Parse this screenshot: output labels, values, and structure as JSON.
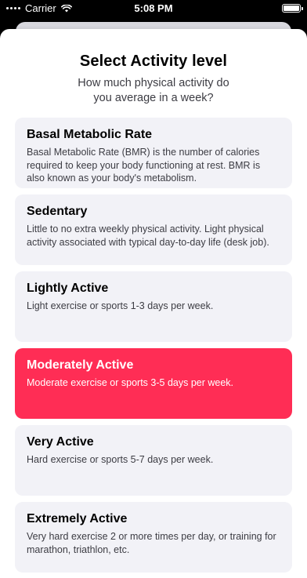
{
  "status_bar": {
    "carrier": "Carrier",
    "time": "5:08 PM"
  },
  "sheet": {
    "title": "Select Activity level",
    "subtitle": "How much physical activity do you average in a week?"
  },
  "activity_levels": [
    {
      "title": "Basal Metabolic Rate",
      "description": "Basal Metabolic Rate (BMR) is the number of calories required to keep your body functioning at rest. BMR is also known as your body's metabolism.",
      "selected": false
    },
    {
      "title": "Sedentary",
      "description": "Little to no extra weekly physical activity. Light physical activity associated with typical day-to-day life (desk job).",
      "selected": false
    },
    {
      "title": "Lightly Active",
      "description": "Light exercise or sports 1-3 days per week.",
      "selected": false
    },
    {
      "title": "Moderately Active",
      "description": "Moderate exercise or sports 3-5 days per week.",
      "selected": true
    },
    {
      "title": "Very Active",
      "description": "Hard exercise or sports 5-7 days per week.",
      "selected": false
    },
    {
      "title": "Extremely Active",
      "description": "Very hard exercise 2 or more times per day, or training for marathon, triathlon, etc.",
      "selected": false
    }
  ],
  "colors": {
    "accent": "#ff2d55",
    "card_background": "#f2f2f7",
    "text_primary": "#000000",
    "text_secondary": "#3c3c43"
  }
}
